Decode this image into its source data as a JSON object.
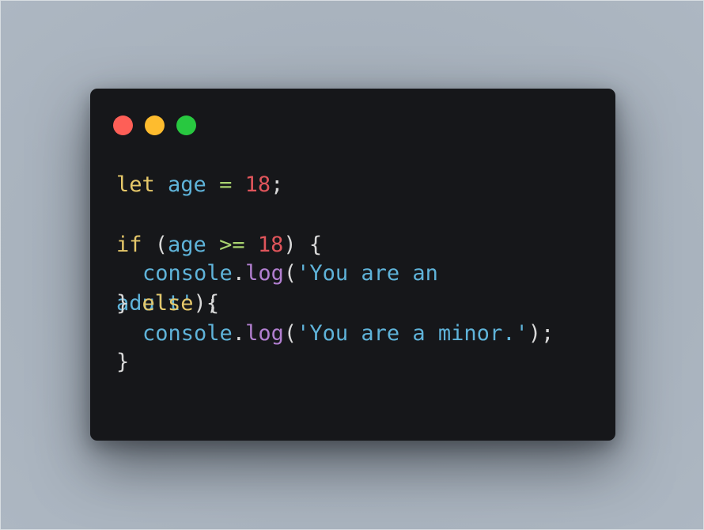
{
  "window": {
    "controls": {
      "close_color": "#fe5f57",
      "minimize_color": "#febc2e",
      "maximize_color": "#28c840"
    }
  },
  "colors": {
    "keyword": "#e6c86a",
    "identifier": "#5fb3d9",
    "operator": "#a9d36f",
    "number": "#e0555b",
    "punctuation": "#d8d8d8",
    "method": "#b27fd0",
    "string": "#5fb3d9"
  },
  "code": {
    "line1": {
      "kw": "let",
      "id": "age",
      "op": "=",
      "num": "18",
      "end": ";"
    },
    "line3": {
      "kw": "if",
      "open": "(",
      "id": "age",
      "op": ">=",
      "num": "18",
      "close": ")",
      "brace": "{"
    },
    "line4": {
      "obj": "console",
      "dot": ".",
      "method": "log",
      "open": "(",
      "str": "'You are an"
    },
    "line5a": {
      "str": "adult'",
      "close": ");"
    },
    "line5b": {
      "brace": "}",
      "kw": "else",
      "open_brace": "{"
    },
    "line6": {
      "obj": "console",
      "dot": ".",
      "method": "log",
      "open": "(",
      "str": "'You are a minor.'",
      "close": ");"
    },
    "line7": {
      "brace": "}"
    }
  }
}
